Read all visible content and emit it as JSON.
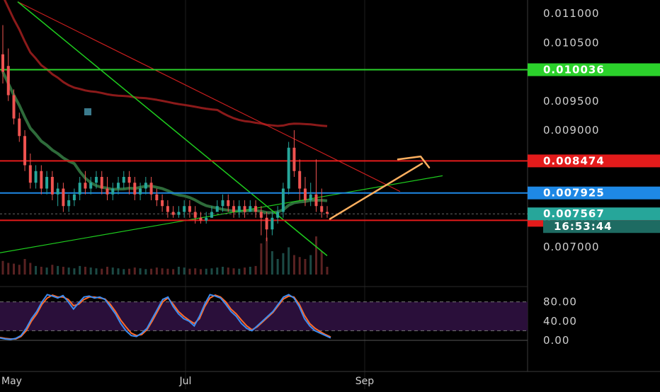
{
  "chart_data": {
    "type": "candlestick",
    "title": "",
    "colors": {
      "background": "#000000",
      "grid": "#2a2a2a",
      "axis_text": "#cfcfcf",
      "up": "#26a69a",
      "down": "#ef5350",
      "ma_green": "#2e6b3a",
      "ma_red": "#8b1a1a",
      "trend_green": "#1ecc1e",
      "trend_red": "#c81e1e",
      "level_green": "#2bd12b",
      "level_red": "#e31b1b",
      "level_blue": "#1e88e5",
      "arrow": "#ffb060",
      "stoch_band": "#2a0f3a",
      "stoch_k": "#3d8cf0",
      "stoch_d": "#ff6a2a"
    },
    "price_axis": {
      "ticks": [
        "0.011000",
        "0.010500",
        "0.009500",
        "0.009000",
        "0.007000"
      ],
      "range": [
        0.00685,
        0.0112
      ]
    },
    "time_axis": {
      "labels": [
        "May",
        "Jul",
        "Sep"
      ]
    },
    "levels": [
      {
        "name": "resistance-high",
        "value": 0.010036,
        "label": "0.010036",
        "color": "#2bd12b"
      },
      {
        "name": "resistance-mid",
        "value": 0.008474,
        "label": "0.008474",
        "color": "#e31b1b"
      },
      {
        "name": "support-blue",
        "value": 0.007925,
        "label": "0.007925",
        "color": "#1e88e5"
      },
      {
        "name": "support-low",
        "value": 0.007456,
        "label": "0.007456",
        "color": "#e31b1b"
      }
    ],
    "last_price": {
      "value": 0.007567,
      "label": "0.007567",
      "countdown": "16:53:44",
      "color": "#26a69a"
    },
    "candles": [
      [
        0.0103,
        0.0108,
        0.01,
        0.0098
      ],
      [
        0.0101,
        0.0104,
        0.0096,
        0.0095
      ],
      [
        0.0096,
        0.0097,
        0.0092,
        0.0091
      ],
      [
        0.0092,
        0.0093,
        0.0089,
        0.0088
      ],
      [
        0.0089,
        0.009,
        0.0084,
        0.0083
      ],
      [
        0.0084,
        0.0086,
        0.0081,
        0.008
      ],
      [
        0.0081,
        0.0084,
        0.0083,
        0.008
      ],
      [
        0.0083,
        0.0084,
        0.008,
        0.0079
      ],
      [
        0.008,
        0.0083,
        0.0082,
        0.0079
      ],
      [
        0.0082,
        0.0083,
        0.0079,
        0.0078
      ],
      [
        0.0079,
        0.0081,
        0.008,
        0.0077
      ],
      [
        0.008,
        0.0081,
        0.0077,
        0.0076
      ],
      [
        0.0077,
        0.0079,
        0.0078,
        0.0076
      ],
      [
        0.0078,
        0.008,
        0.0079,
        0.0077
      ],
      [
        0.0079,
        0.0082,
        0.0081,
        0.0078
      ],
      [
        0.0081,
        0.0083,
        0.008,
        0.0079
      ],
      [
        0.008,
        0.0082,
        0.0081,
        0.0079
      ],
      [
        0.0081,
        0.0083,
        0.0082,
        0.008
      ],
      [
        0.0082,
        0.0083,
        0.008,
        0.0079
      ],
      [
        0.008,
        0.0082,
        0.0079,
        0.0078
      ],
      [
        0.0079,
        0.0081,
        0.008,
        0.0078
      ],
      [
        0.008,
        0.0082,
        0.0081,
        0.0079
      ],
      [
        0.0081,
        0.0083,
        0.0082,
        0.008
      ],
      [
        0.0082,
        0.0083,
        0.0081,
        0.0079
      ],
      [
        0.0081,
        0.0082,
        0.0079,
        0.0078
      ],
      [
        0.0079,
        0.0081,
        0.008,
        0.0078
      ],
      [
        0.008,
        0.0082,
        0.0081,
        0.0079
      ],
      [
        0.0081,
        0.0082,
        0.0079,
        0.0078
      ],
      [
        0.0079,
        0.008,
        0.0078,
        0.0077
      ],
      [
        0.0078,
        0.0079,
        0.0077,
        0.0076
      ],
      [
        0.0077,
        0.0078,
        0.0076,
        0.0075
      ],
      [
        0.0076,
        0.0077,
        0.00755,
        0.0075
      ],
      [
        0.00755,
        0.0077,
        0.0076,
        0.0075
      ],
      [
        0.0076,
        0.0078,
        0.0077,
        0.0075
      ],
      [
        0.0077,
        0.0078,
        0.0076,
        0.0075
      ],
      [
        0.0076,
        0.0077,
        0.0075,
        0.0074
      ],
      [
        0.0075,
        0.0076,
        0.00745,
        0.0074
      ],
      [
        0.00745,
        0.0076,
        0.0075,
        0.0074
      ],
      [
        0.0075,
        0.0077,
        0.0076,
        0.0075
      ],
      [
        0.0076,
        0.0078,
        0.0077,
        0.0076
      ],
      [
        0.0077,
        0.0079,
        0.0078,
        0.0076
      ],
      [
        0.0078,
        0.0079,
        0.0077,
        0.0076
      ],
      [
        0.0077,
        0.0078,
        0.0076,
        0.0075
      ],
      [
        0.0076,
        0.0078,
        0.0077,
        0.0075
      ],
      [
        0.0077,
        0.0078,
        0.0076,
        0.0075
      ],
      [
        0.0076,
        0.0078,
        0.0077,
        0.0076
      ],
      [
        0.0077,
        0.0078,
        0.0076,
        0.0075
      ],
      [
        0.0076,
        0.0077,
        0.0075,
        0.0072
      ],
      [
        0.0075,
        0.0076,
        0.0073,
        0.0071
      ],
      [
        0.0073,
        0.0076,
        0.0075,
        0.0072
      ],
      [
        0.0075,
        0.0077,
        0.0076,
        0.0074
      ],
      [
        0.0076,
        0.0081,
        0.008,
        0.0075
      ],
      [
        0.008,
        0.0088,
        0.0087,
        0.0079
      ],
      [
        0.0087,
        0.009,
        0.0083,
        0.0082
      ],
      [
        0.0083,
        0.0085,
        0.008,
        0.0078
      ],
      [
        0.008,
        0.0082,
        0.0078,
        0.0077
      ],
      [
        0.0078,
        0.0081,
        0.0079,
        0.0077
      ],
      [
        0.0079,
        0.0085,
        0.0077,
        0.0076
      ],
      [
        0.0077,
        0.008,
        0.0076,
        0.0075
      ],
      [
        0.0076,
        0.0077,
        0.00757,
        0.0075
      ]
    ],
    "volumes": [
      0.35,
      0.3,
      0.28,
      0.25,
      0.4,
      0.3,
      0.22,
      0.2,
      0.18,
      0.25,
      0.22,
      0.2,
      0.18,
      0.16,
      0.22,
      0.2,
      0.18,
      0.16,
      0.15,
      0.2,
      0.18,
      0.16,
      0.14,
      0.15,
      0.18,
      0.16,
      0.14,
      0.15,
      0.18,
      0.16,
      0.15,
      0.14,
      0.2,
      0.18,
      0.15,
      0.16,
      0.14,
      0.15,
      0.16,
      0.18,
      0.2,
      0.18,
      0.16,
      0.15,
      0.18,
      0.2,
      0.22,
      0.8,
      0.95,
      0.6,
      0.4,
      0.55,
      0.7,
      0.5,
      0.45,
      0.4,
      0.5,
      0.98,
      0.6,
      0.2
    ],
    "stochastic": {
      "ticks": [
        "80.00",
        "40.00",
        "0.00"
      ],
      "band": [
        20,
        80
      ],
      "k": [
        5,
        3,
        2,
        4,
        10,
        25,
        45,
        60,
        80,
        95,
        92,
        88,
        93,
        80,
        65,
        78,
        90,
        92,
        88,
        90,
        85,
        70,
        55,
        35,
        20,
        10,
        8,
        15,
        25,
        45,
        65,
        85,
        90,
        70,
        55,
        45,
        40,
        30,
        50,
        75,
        95,
        92,
        88,
        75,
        60,
        50,
        35,
        25,
        20,
        30,
        40,
        50,
        60,
        75,
        90,
        95,
        88,
        70,
        45,
        30,
        20,
        15,
        10,
        5
      ],
      "d": [
        6,
        4,
        3,
        3,
        8,
        20,
        40,
        55,
        75,
        88,
        94,
        90,
        90,
        85,
        72,
        75,
        85,
        90,
        90,
        88,
        86,
        75,
        60,
        42,
        28,
        15,
        10,
        12,
        22,
        40,
        60,
        80,
        88,
        75,
        60,
        50,
        42,
        35,
        45,
        70,
        88,
        94,
        90,
        80,
        65,
        55,
        42,
        30,
        22,
        28,
        38,
        48,
        58,
        72,
        86,
        92,
        90,
        75,
        52,
        35,
        25,
        18,
        12,
        7
      ]
    }
  }
}
